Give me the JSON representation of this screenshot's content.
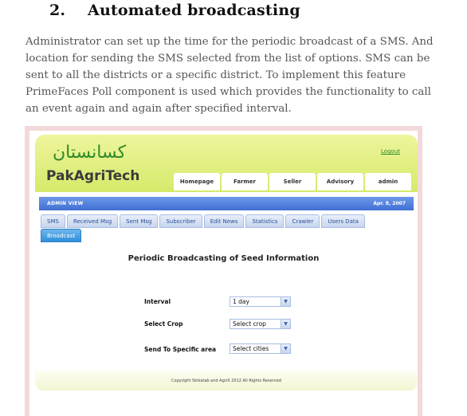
{
  "doc": {
    "section_number": "2.",
    "section_title": "Automated broadcasting",
    "paragraph": "Administrator can set up the time for the periodic broadcast of a SMS. And location for sending the SMS selected from the list of options. SMS can be sent to all the districts or a specific district. To implement this feature PrimeFaces Poll component is used which provides the functionality to call an event again and again after specified interval."
  },
  "app": {
    "logo_urdu": "کسانستان",
    "logo_text": "PakAgriTech",
    "logout": "Logout",
    "nav": [
      "Homepage",
      "Farmer",
      "Seller",
      "Advisory",
      "admin"
    ],
    "admin_view_label": "ADMIN VIEW",
    "date": "Apr. 8, 2007",
    "tabs_row1": [
      "SMS",
      "Received Msg",
      "Sent Msg",
      "Subscriber",
      "Edit News",
      "Statistics",
      "Crawler",
      "Users Data"
    ],
    "tabs_row2": [
      "Broadcast"
    ],
    "active_tab": "Broadcast",
    "content_title": "Periodic Broadcasting of Seed Information",
    "form": {
      "interval_label": "Interval",
      "interval_value": "1 day",
      "crop_label": "Select Crop",
      "crop_value": "Select crop",
      "area_label": "Send To Specific area",
      "area_value": "Select cities"
    },
    "footer": "Copyright Skikatab and AgriX 2012 All Rights Reserved"
  },
  "colors": {
    "banner_green": "#d7e96a",
    "admin_bar_blue": "#3f6fd4",
    "active_tab_blue": "#2f8fd9",
    "frame_pink": "#f3d9da"
  }
}
